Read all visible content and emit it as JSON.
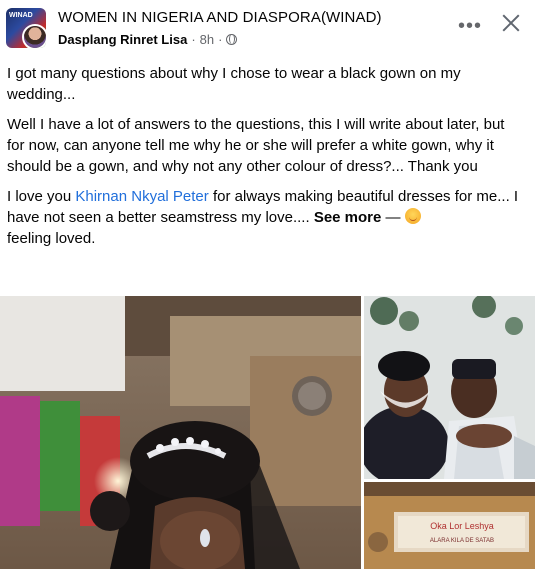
{
  "post": {
    "group_name": "WOMEN IN NIGERIA AND DIASPORA(WINAD)",
    "author": "Dasplang Rinret Lisa",
    "time": "8h",
    "separator": "·",
    "paragraph_1": "I got many questions about why I chose to wear a black gown on my wedding...",
    "paragraph_2": "Well I have a lot of answers to the questions, this I will write about later, but for now, can anyone tell me why he or she will prefer a white gown, why it should be a gown, and why not any other colour of dress?... Thank you",
    "paragraph_3_start": "I love you ",
    "mention": "Khirnan Nkyal Peter",
    "paragraph_3_end": " for always making beautiful dresses for me... I have not seen a better seamstress my love.... ",
    "see_more": "See more",
    "feeling_dash": " — ",
    "feeling": "feeling loved."
  },
  "header": {
    "more_label": "•••",
    "avatar_text": "WINAD"
  },
  "photos": {
    "shop_sign_line_1": "Oka Lor Leshya",
    "shop_sign_line_2": "ALARA KILA DE SATAB"
  },
  "icons": [
    "group-avatar-icon",
    "globe-icon",
    "more-icon",
    "close-icon",
    "emoji-icon"
  ],
  "colors": {
    "mention": "#216fdb",
    "meta": "#65676b",
    "text": "#050505"
  }
}
